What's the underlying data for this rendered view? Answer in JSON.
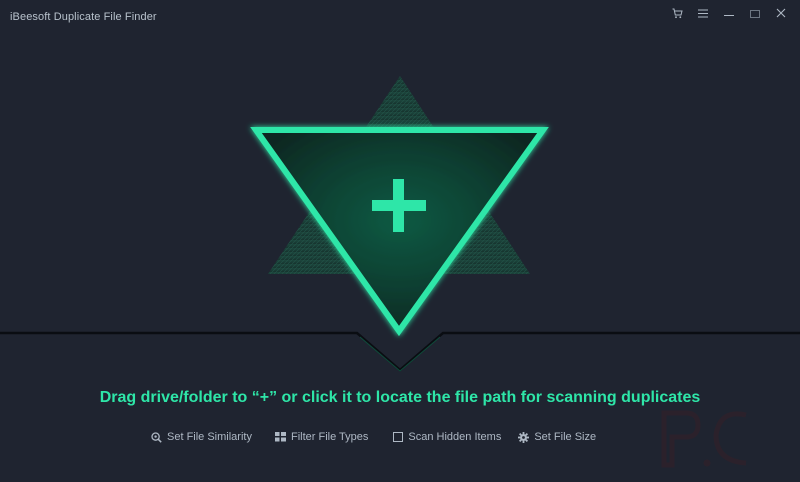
{
  "window": {
    "title": "iBeesoft Duplicate File Finder",
    "controls": [
      "cart-icon",
      "menu-icon",
      "minimize-icon",
      "maximize-icon",
      "close-icon"
    ]
  },
  "hero": {
    "button_symbol": "+",
    "accent_color": "#2ee6a8"
  },
  "main": {
    "hint": "Drag drive/folder to “+” or click it to locate the file path for scanning duplicates"
  },
  "options": {
    "items": [
      {
        "label": "Set File Similarity",
        "icon": "magnify-icon"
      },
      {
        "label": "Filter File Types",
        "icon": "grid-icon"
      },
      {
        "label": "Scan Hidden Items",
        "icon": "checkbox-icon",
        "checked": false
      },
      {
        "label": "Set File Size",
        "icon": "gear-icon"
      }
    ]
  },
  "colors": {
    "background": "#1f2430",
    "accent": "#2ee6a8",
    "text_muted": "#aeb8c4"
  }
}
